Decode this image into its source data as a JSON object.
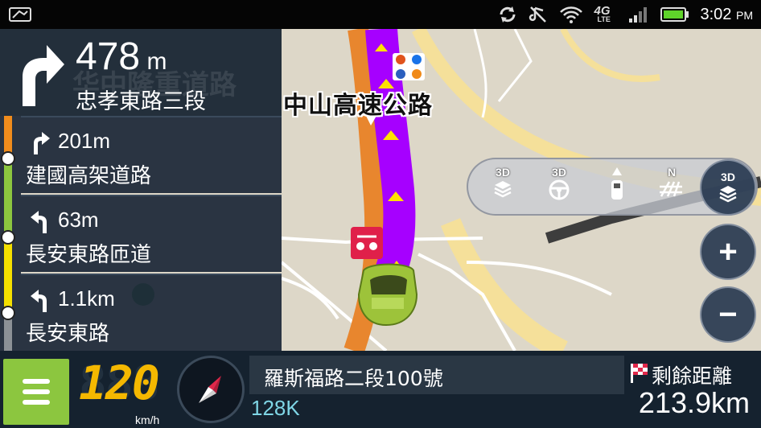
{
  "status_bar": {
    "icons": [
      "sim-card-icon",
      "sync-icon",
      "mute-icon",
      "wifi-icon",
      "4g-lte-icon",
      "signal-icon",
      "battery-icon"
    ],
    "network_label": "4G",
    "network_sublabel": "LTE",
    "time": "3:02",
    "time_suffix": "PM"
  },
  "map": {
    "road_label": "中山高速公路",
    "colors": {
      "route": "#a600ff",
      "highway": "#e8862e",
      "background": "#ddd7c8",
      "secondary_road": "#f7e3a0"
    }
  },
  "next_turn": {
    "distance_value": "478",
    "distance_unit": "m",
    "road": "忠孝東路三段",
    "watermark": "华中隆重道路",
    "arrow_icon": "turn-right-icon"
  },
  "upcoming_steps": [
    {
      "distance": "201m",
      "road": "建國高架道路",
      "arrow_icon": "turn-right-icon"
    },
    {
      "distance": "63m",
      "road": "長安東路匝道",
      "arrow_icon": "turn-left-icon"
    },
    {
      "distance": "1.1km",
      "road": "長安東路",
      "arrow_icon": "turn-left-icon"
    }
  ],
  "view_modes": [
    {
      "label": "3D",
      "icon": "3d-building-icon"
    },
    {
      "label": "3D",
      "icon": "steering-wheel-icon"
    },
    {
      "label": "",
      "icon": "car-heading-icon"
    },
    {
      "label": "N",
      "icon": "north-up-grid-icon"
    }
  ],
  "active_view_mode": {
    "label": "3D",
    "icon": "3d-building-icon"
  },
  "zoom": {
    "in_symbol": "+",
    "out_symbol": "−"
  },
  "bottom_bar": {
    "speed": "120",
    "speed_ghost": "888",
    "speed_unit": "km/h",
    "address": "羅斯福路二段100號",
    "sub_info": "128K",
    "remaining_label": "剩餘距離",
    "remaining_value": "213.9km"
  }
}
